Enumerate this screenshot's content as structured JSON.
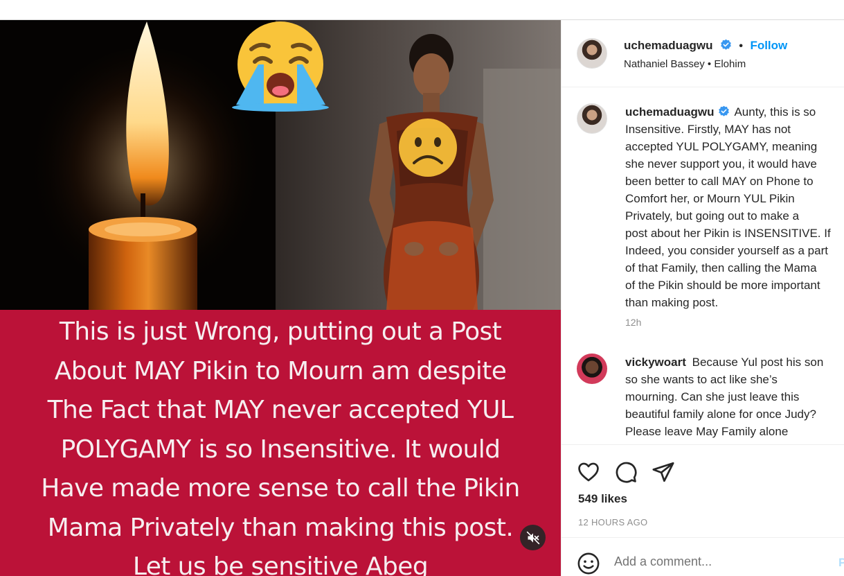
{
  "post": {
    "author": "uchemaduagwu",
    "follow_label": "Follow",
    "separator": "•",
    "audio_artist": "Nathaniel Bassey",
    "audio_title": "Elohim",
    "likes": "549 likes",
    "time_ago": "12 HOURS AGO"
  },
  "image_caption_lines": [
    "This is just Wrong, putting out a Post",
    "About MAY Pikin to Mourn am despite",
    "The Fact that MAY never accepted YUL",
    "POLYGAMY is so Insensitive. It would",
    "Have made more sense to call the Pikin",
    "Mama Privately than making this post.",
    "Let us be sensitive Abeg"
  ],
  "comments": [
    {
      "username": "uchemaduagwu",
      "lines": [
        "Aunty, this is so",
        "Insensitive. Firstly, MAY has not",
        "accepted YUL POLYGAMY, meaning",
        "she never support you, it would have",
        "been better to call MAY on Phone to",
        "Comfort her, or Mourn YUL Pikin",
        "Privately, but going out to make a",
        "post about her Pikin is INSENSITIVE. If",
        "Indeed, you consider yourself as a part",
        "of that Family, then calling the Mama",
        "of the Pikin should be more important",
        "than making post."
      ],
      "time": "12h"
    },
    {
      "username": "vickywoart",
      "lines": [
        "Because Yul post his son",
        "so she wants to act like she’s",
        "mourning. Can she just leave this",
        "beautiful family alone for once Judy?",
        "Please leave May Family alone"
      ]
    }
  ],
  "comment_input": {
    "placeholder": "Add a comment...",
    "post_label": "Post"
  },
  "icons": {
    "verified": "verified-badge-icon",
    "like": "heart-icon",
    "comment": "comment-icon",
    "share": "send-icon",
    "emoji": "emoji-icon",
    "mute": "audio-muted-icon",
    "candle": "candle-image",
    "crying_emoji": "crying-face-emoji",
    "frowning_emoji": "frowning-face-emoji"
  },
  "colors": {
    "accent_blue": "#0095f6",
    "caption_background": "#bb1238",
    "verified_blue": "#3897f0"
  }
}
